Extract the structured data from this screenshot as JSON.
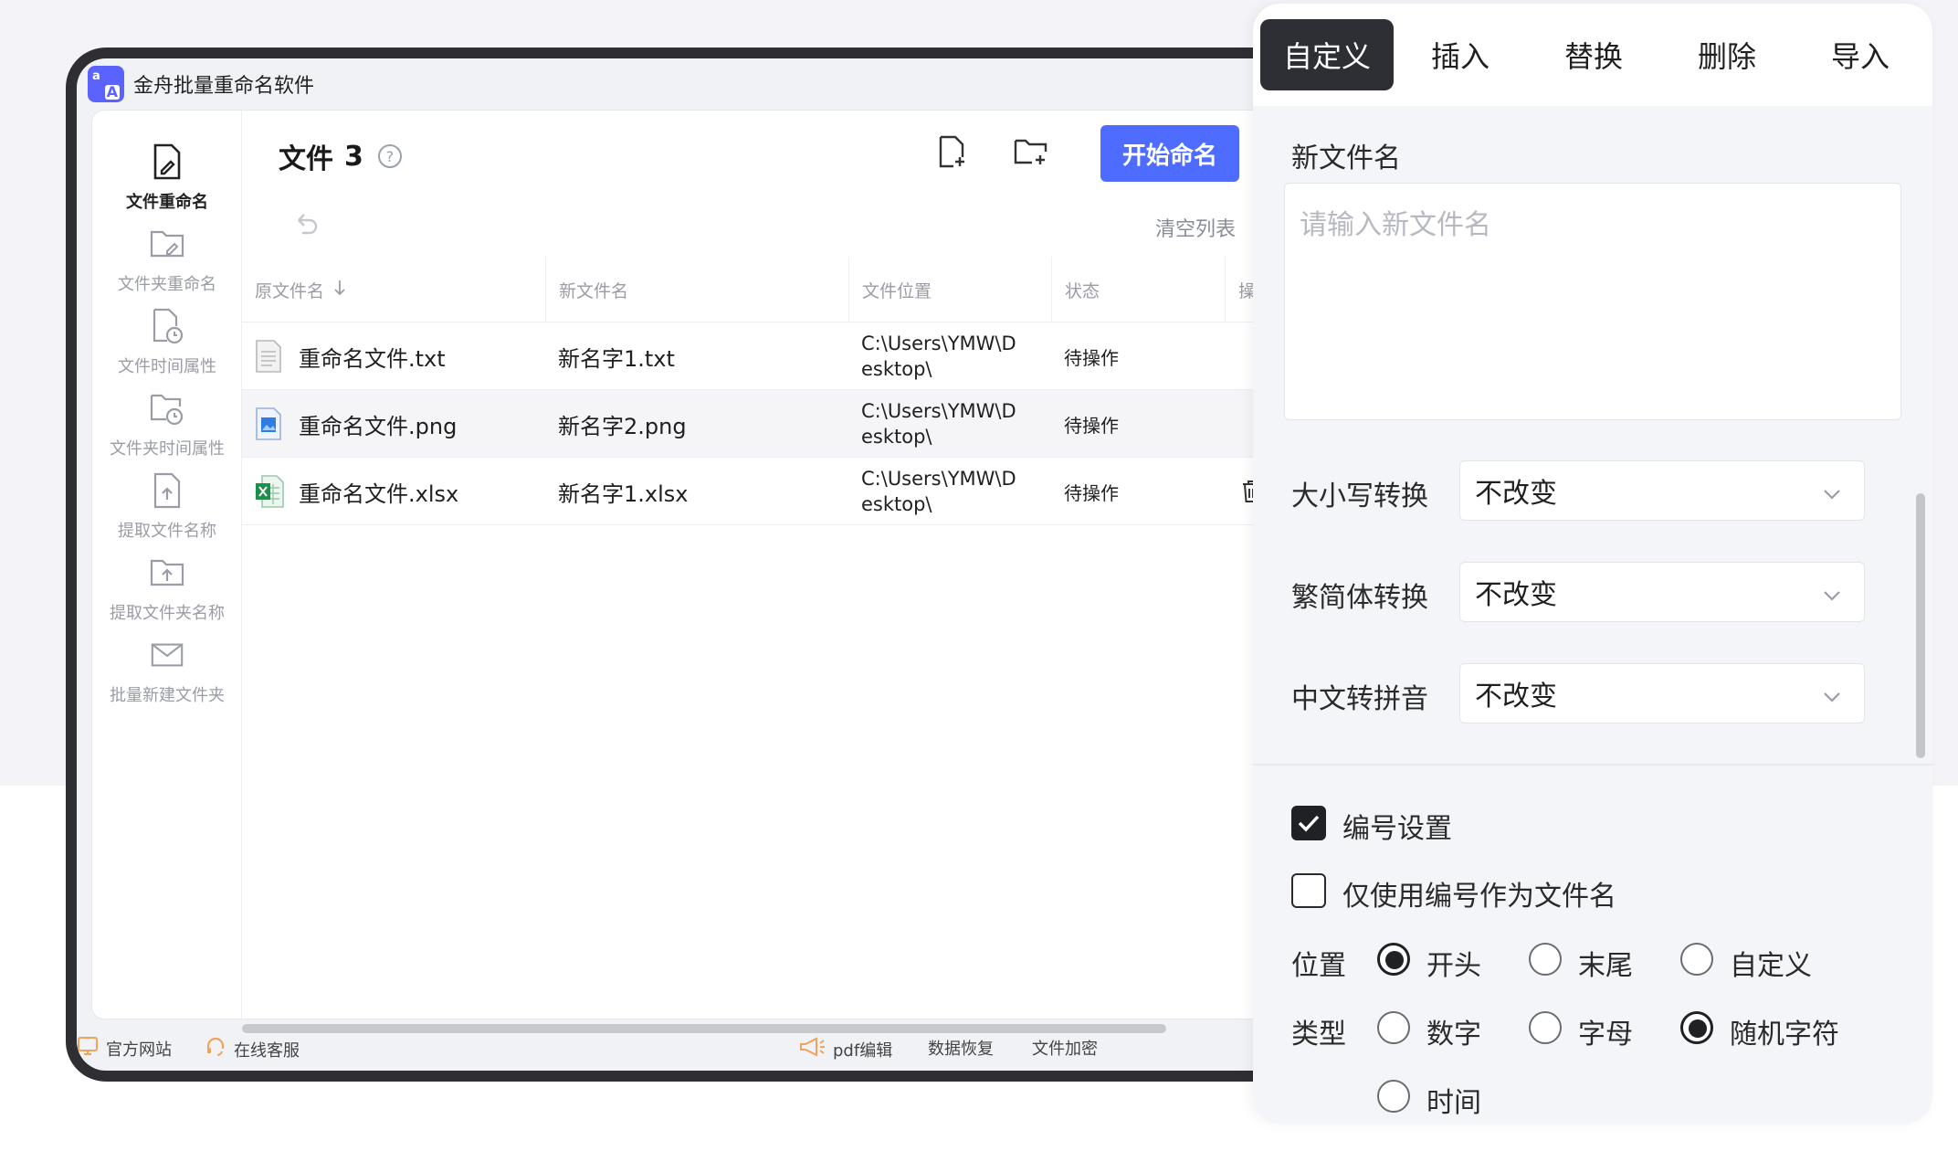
{
  "app": {
    "title": "金舟批量重命名软件",
    "logo_text_1": "a",
    "logo_text_2": "A"
  },
  "sidebar": {
    "items": [
      {
        "label": "文件重命名",
        "icon": "file-rename-icon",
        "active": true
      },
      {
        "label": "文件夹重命名",
        "icon": "folder-rename-icon"
      },
      {
        "label": "文件时间属性",
        "icon": "file-time-icon"
      },
      {
        "label": "文件夹时间属性",
        "icon": "folder-time-icon"
      },
      {
        "label": "提取文件名称",
        "icon": "extract-file-name-icon"
      },
      {
        "label": "提取文件夹名称",
        "icon": "extract-folder-name-icon"
      },
      {
        "label": "批量新建文件夹",
        "icon": "batch-new-folder-icon"
      }
    ]
  },
  "main": {
    "title": "文件",
    "count": "3",
    "help": "?",
    "start_button": "开始命名",
    "clear_list": "清空列表",
    "columns": [
      "原文件名",
      "新文件名",
      "文件位置",
      "状态",
      "操"
    ],
    "rows": [
      {
        "original": "重命名文件.txt",
        "new": "新名字1.txt",
        "path": "C:\\Users\\YMW\\Desktop\\",
        "status": "待操作",
        "icon": "txt-file-icon"
      },
      {
        "original": "重命名文件.png",
        "new": "新名字2.png",
        "path": "C:\\Users\\YMW\\Desktop\\",
        "status": "待操作",
        "icon": "png-file-icon"
      },
      {
        "original": "重命名文件.xlsx",
        "new": "新名字1.xlsx",
        "path": "C:\\Users\\YMW\\Desktop\\",
        "status": "待操作",
        "icon": "xlsx-file-icon"
      }
    ]
  },
  "footer": {
    "website": "官方网站",
    "support": "在线客服",
    "pdf": "pdf编辑",
    "recovery": "数据恢复",
    "encrypt": "文件加密"
  },
  "panel": {
    "tabs": [
      "自定义",
      "插入",
      "替换",
      "删除",
      "导入"
    ],
    "active_tab": "自定义",
    "new_name_label": "新文件名",
    "new_name_placeholder": "请输入新文件名",
    "case_label": "大小写转换",
    "case_value": "不改变",
    "trad_label": "繁简体转换",
    "trad_value": "不改变",
    "pinyin_label": "中文转拼音",
    "pinyin_value": "不改变",
    "numbering_label": "编号设置",
    "numbering_checked": true,
    "only_number_label": "仅使用编号作为文件名",
    "only_number_checked": false,
    "position_label": "位置",
    "position_options": [
      "开头",
      "末尾",
      "自定义"
    ],
    "position_selected": "开头",
    "type_label": "类型",
    "type_options": [
      "数字",
      "字母",
      "随机字符",
      "时间"
    ],
    "type_selected": "随机字符"
  },
  "colors": {
    "accent": "#4e6cff",
    "dark_tab": "#2d2f34",
    "frame": "#2e2e33"
  }
}
